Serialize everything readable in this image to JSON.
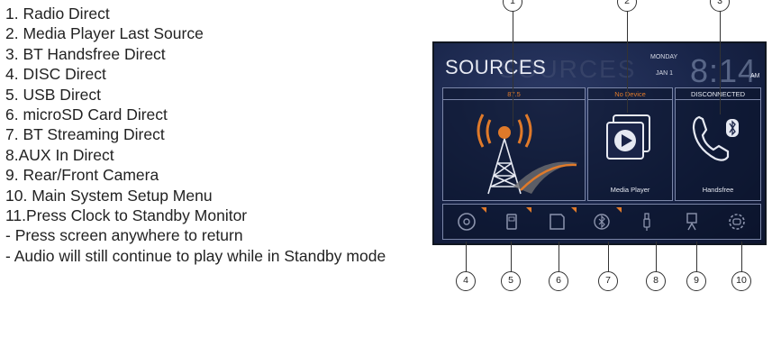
{
  "legend": [
    "1. Radio Direct",
    "2. Media Player Last Source",
    "3. BT Handsfree Direct",
    "4. DISC Direct",
    "5. USB Direct",
    "6. microSD Card Direct",
    "7. BT Streaming Direct",
    "8.AUX In Direct",
    "9. Rear/Front Camera",
    "10. Main System Setup Menu",
    "11.Press Clock to Standby Monitor",
    "- Press screen anywhere to return",
    "- Audio will still continue to play while in Standby mode"
  ],
  "screen": {
    "title": "SOURCES",
    "title_ghost": "SOURCES",
    "day": "MONDAY",
    "date": "JAN 1",
    "clock": "8:14",
    "ampm": "AM",
    "radio": {
      "header": "87.5"
    },
    "media": {
      "header": "No Device",
      "label": "Media Player"
    },
    "phone": {
      "header": "DISCONNECTED",
      "label": "Handsfree"
    }
  },
  "callouts": [
    "1",
    "2",
    "3",
    "4",
    "5",
    "6",
    "7",
    "8",
    "9",
    "10"
  ],
  "colors": {
    "accent": "#e07a2a",
    "screen_bg": "#182448",
    "frame": "#7b86a8"
  }
}
